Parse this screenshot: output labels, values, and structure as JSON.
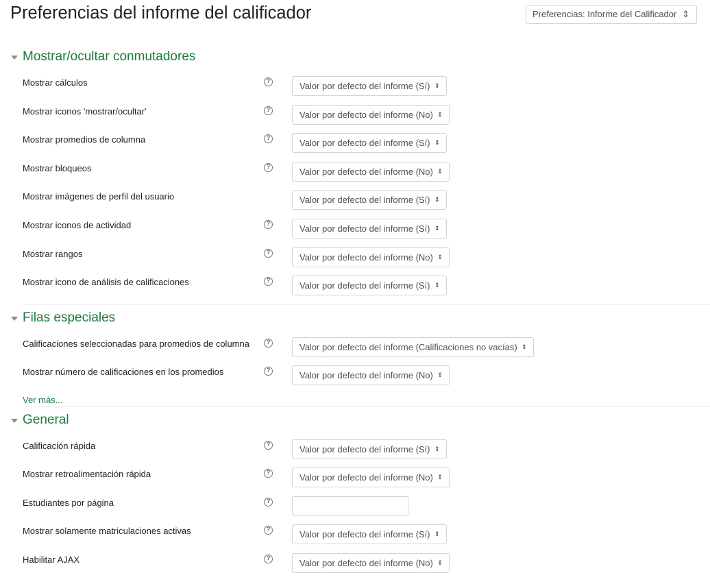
{
  "page": {
    "title": "Preferencias del informe del calificador"
  },
  "jump": {
    "value": "Preferencias: Informe del Calificador"
  },
  "sections": {
    "toggles": {
      "title": "Mostrar/ocultar conmutadores"
    },
    "special": {
      "title": "Filas especiales",
      "more": "Ver más..."
    },
    "general": {
      "title": "General"
    }
  },
  "rows": [
    {
      "label": "Mostrar cálculos",
      "value": "Valor por defecto del informe (Sí)",
      "help": true
    },
    {
      "label": "Mostrar iconos 'mostrar/ocultar'",
      "value": "Valor por defecto del informe (No)",
      "help": true
    },
    {
      "label": "Mostrar promedios de columna",
      "value": "Valor por defecto del informe (Sí)",
      "help": true
    },
    {
      "label": "Mostrar bloqueos",
      "value": "Valor por defecto del informe (No)",
      "help": true
    },
    {
      "label": "Mostrar imágenes de perfil del usuario",
      "value": "Valor por defecto del informe (Sí)",
      "help": false
    },
    {
      "label": "Mostrar iconos de actividad",
      "value": "Valor por defecto del informe (Sí)",
      "help": true
    },
    {
      "label": "Mostrar rangos",
      "value": "Valor por defecto del informe (No)",
      "help": true
    },
    {
      "label": "Mostrar icono de análisis de calificaciones",
      "value": "Valor por defecto del informe (Sí)",
      "help": true
    },
    {
      "label": "Calificaciones seleccionadas para promedios de columna",
      "value": "Valor por defecto del informe (Calificaciones no vacías)",
      "help": true
    },
    {
      "label": "Mostrar número de calificaciones en los promedios",
      "value": "Valor por defecto del informe (No)",
      "help": true
    },
    {
      "label": "Calificación rápida",
      "value": "Valor por defecto del informe (Sí)",
      "help": true
    },
    {
      "label": "Mostrar retroalimentación rápida",
      "value": "Valor por defecto del informe (No)",
      "help": true
    },
    {
      "label": "Estudiantes por página",
      "value": "",
      "help": true
    },
    {
      "label": "Mostrar solamente matriculaciones activas",
      "value": "Valor por defecto del informe (Sí)",
      "help": true
    },
    {
      "label": "Habilitar AJAX",
      "value": "Valor por defecto del informe (No)",
      "help": true
    }
  ],
  "icons": {
    "help": "help-circle-icon",
    "collapse": "triangle-down-icon",
    "select_caret": "updown-caret-icon"
  },
  "colors": {
    "section_title": "#1a7a3d",
    "text": "#1d2125",
    "border": "#ced4da"
  }
}
